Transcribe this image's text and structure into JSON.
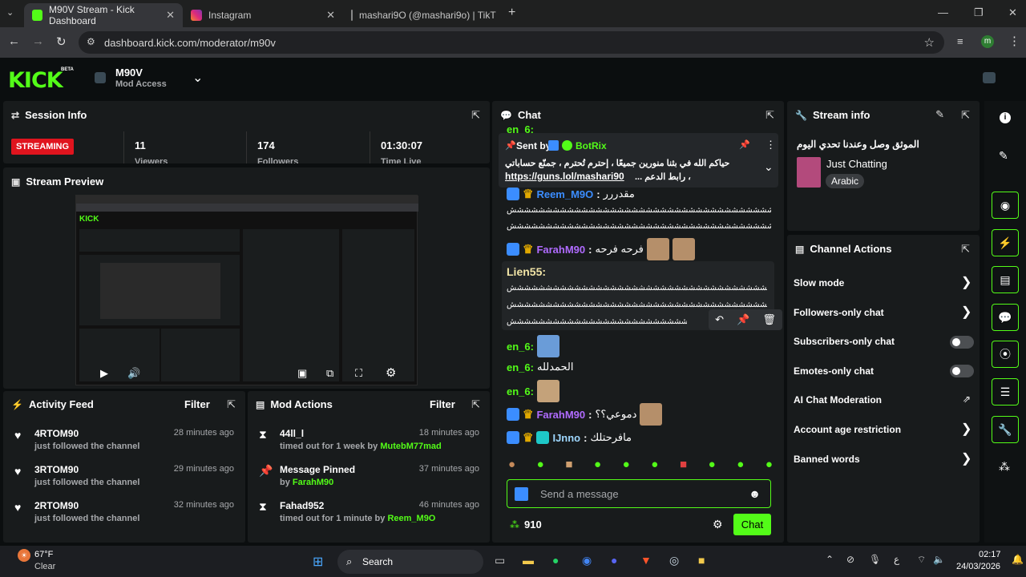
{
  "browser": {
    "tabs": [
      {
        "label": "M90V Stream - Kick Dashboard",
        "icon": "kick-icon",
        "color": "#53fc18"
      },
      {
        "label": "Instagram",
        "icon": "instagram-icon",
        "color": "#e1306c"
      },
      {
        "label": "mashari9O (@mashari9o) | TikT",
        "icon": "tiktok-icon",
        "color": "#000000"
      }
    ],
    "url": "dashboard.kick.com/moderator/m90v",
    "profile": "m"
  },
  "header": {
    "logo": "KICK",
    "beta": "BETA",
    "channel": "M90V",
    "role": "Mod Access"
  },
  "session": {
    "title": "Session Info",
    "status": "STREAMING",
    "viewers": "11",
    "followers": "174",
    "time": "01:30:07",
    "viewers_label": "Viewers",
    "followers_label": "Followers",
    "time_label": "Time Live"
  },
  "preview": {
    "title": "Stream Preview"
  },
  "activity": {
    "title": "Activity Feed",
    "filter": "Filter",
    "items": [
      {
        "name": "4RTOM90",
        "action": "just followed the channel",
        "time": "28 minutes ago"
      },
      {
        "name": "3RTOM90",
        "action": "just followed the channel",
        "time": "29 minutes ago"
      },
      {
        "name": "2RTOM90",
        "action": "just followed the channel",
        "time": "32 minutes ago"
      }
    ]
  },
  "mod": {
    "title": "Mod Actions",
    "filter": "Filter",
    "items": [
      {
        "title": "44ll_l",
        "sub": "timed out for 1 week by ",
        "by": "MutebM77mad",
        "time": "18 minutes ago"
      },
      {
        "title": "Message Pinned",
        "sub": "by ",
        "by": "FarahM90",
        "time": "37 minutes ago"
      },
      {
        "title": "Fahad952",
        "sub": "timed out for 1 minute by ",
        "by": "Reem_M9O",
        "time": "46 minutes ago"
      }
    ]
  },
  "chat": {
    "title": "Chat",
    "pinned": {
      "sent_by": "Sent by",
      "author": "BotRix",
      "text1": "حياكم الله في بثنا منورين جميعًا ، إحترم تُحترم ، جمنّع حساباتي",
      "link": "https://guns.lol/mashari90",
      "text2": "، رابط الدعم ..."
    },
    "top_fragment": "en_6:",
    "messages": [
      {
        "user": "Reem_M9O",
        "text": "مقدررر",
        "extra": "ششششششششششششششششششششششششششششششششششششششش"
      },
      {
        "user": "FarahM90",
        "text": "فرحه فرحه"
      },
      {
        "user": "Lien55:",
        "text": "ششششششششششششششششششششششششششششششششششششششش"
      },
      {
        "user": "en_6:",
        "text": ""
      },
      {
        "user": "en_6:",
        "text": "الحمدلله"
      },
      {
        "user": "en_6:",
        "text": ""
      },
      {
        "user": "FarahM90",
        "text": "دموعي؟؟"
      },
      {
        "user": "IJnno",
        "text": "مافرحتلك"
      }
    ],
    "placeholder": "Send a message",
    "points": "910",
    "send": "Chat"
  },
  "stream_info": {
    "title": "Stream info",
    "stream_title": "الموثق وصل وعندنا تحدي اليوم",
    "category": "Just Chatting",
    "language": "Arabic"
  },
  "channel_actions": {
    "title": "Channel Actions",
    "items": [
      {
        "label": "Slow mode",
        "control": "chevron"
      },
      {
        "label": "Followers-only chat",
        "control": "chevron"
      },
      {
        "label": "Subscribers-only chat",
        "control": "toggle"
      },
      {
        "label": "Emotes-only chat",
        "control": "toggle"
      },
      {
        "label": "AI Chat Moderation",
        "control": "external"
      },
      {
        "label": "Account age restriction",
        "control": "chevron"
      },
      {
        "label": "Banned words",
        "control": "chevron"
      }
    ]
  },
  "taskbar": {
    "temp": "67°F",
    "weather": "Clear",
    "search": "Search",
    "time": "02:17",
    "date": "24/03/2026",
    "lang": "ع"
  }
}
